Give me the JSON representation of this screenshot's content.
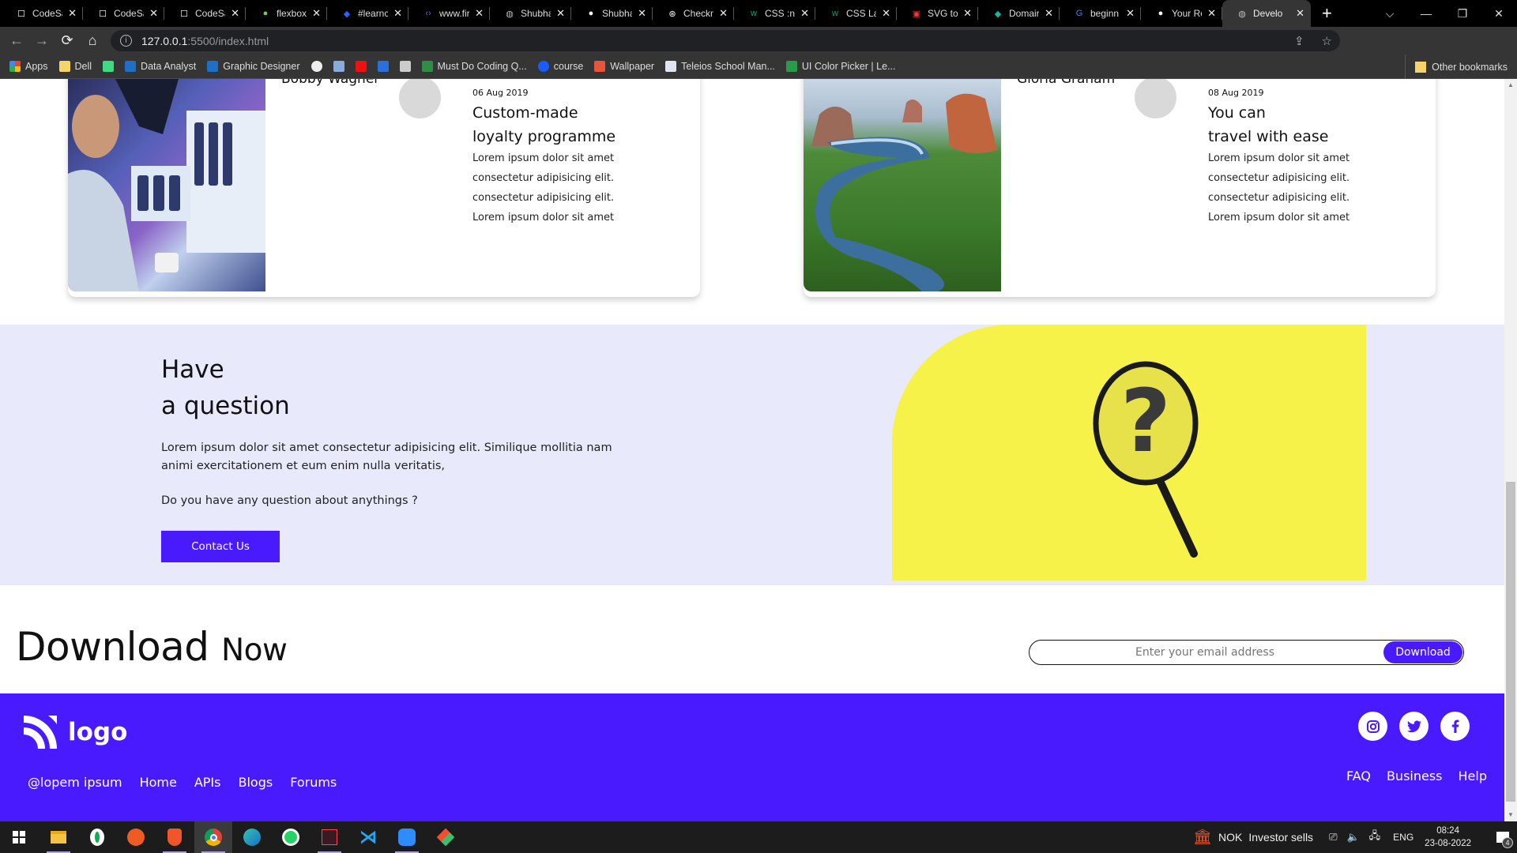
{
  "browser": {
    "tabs": [
      {
        "title": "CodeSa",
        "icon": "codesandbox-icon",
        "active": false
      },
      {
        "title": "CodeSa",
        "icon": "codesandbox-icon",
        "active": false
      },
      {
        "title": "CodeSa",
        "icon": "codesandbox-icon",
        "active": false
      },
      {
        "title": "flexbox",
        "icon": "frog-icon",
        "active": false
      },
      {
        "title": "#learnc",
        "icon": "hashnode-icon",
        "active": false
      },
      {
        "title": "www.fir",
        "icon": "code-icon",
        "active": false
      },
      {
        "title": "Shubha",
        "icon": "globe-icon",
        "active": false
      },
      {
        "title": "Shubha",
        "icon": "github-icon",
        "active": false
      },
      {
        "title": "Checkm",
        "icon": "openai-icon",
        "active": false
      },
      {
        "title": "CSS :nt",
        "icon": "w3schools-icon",
        "active": false
      },
      {
        "title": "CSS Lay",
        "icon": "w3schools-icon",
        "active": false
      },
      {
        "title": "SVG to",
        "icon": "svgpng-icon",
        "active": false
      },
      {
        "title": "Domair",
        "icon": "diamond-icon",
        "active": false
      },
      {
        "title": "beginn",
        "icon": "google-icon",
        "active": false
      },
      {
        "title": "Your Re",
        "icon": "github-icon",
        "active": false
      },
      {
        "title": "Develo",
        "icon": "globe-icon",
        "active": true
      }
    ],
    "url_host": "127.0.0.1",
    "url_path": ":5500/index.html",
    "bookmarks": [
      {
        "label": "Apps",
        "icon": "apps-grid-icon"
      },
      {
        "label": "Dell",
        "icon": "folder-icon"
      },
      {
        "label": "",
        "icon": "android-icon"
      },
      {
        "label": "Data Analyst",
        "icon": "video-icon"
      },
      {
        "label": "Graphic Designer",
        "icon": "video-icon"
      },
      {
        "label": "",
        "icon": "globe-icon"
      },
      {
        "label": "",
        "icon": "mountain-icon"
      },
      {
        "label": "",
        "icon": "t-logo-icon"
      },
      {
        "label": "",
        "icon": "dc-icon"
      },
      {
        "label": "",
        "icon": "badge-icon"
      },
      {
        "label": "Must Do Coding Q...",
        "icon": "gfg-icon"
      },
      {
        "label": "course",
        "icon": "c-logo-icon"
      },
      {
        "label": "Wallpaper",
        "icon": "flame-icon"
      },
      {
        "label": "Teleios School Man...",
        "icon": "document-icon"
      },
      {
        "label": "UI Color Picker | Le...",
        "icon": "play-icon"
      }
    ],
    "other_bookmarks": "Other bookmarks"
  },
  "cards": [
    {
      "author": "Bobby Wagner",
      "date": "06 Aug 2019",
      "title_line1": "Custom-made",
      "title_line2": "loyalty programme",
      "body": [
        "Lorem ipsum dolor sit amet",
        "consectetur adipisicing elit.",
        "consectetur adipisicing elit.",
        "Lorem ipsum dolor sit amet"
      ]
    },
    {
      "author": "Gloria Graham",
      "date": "08 Aug 2019",
      "title_line1": "You can",
      "title_line2": "travel with ease",
      "body": [
        "Lorem ipsum dolor sit amet",
        "consectetur adipisicing elit.",
        "consectetur adipisicing elit.",
        "Lorem ipsum dolor sit amet"
      ]
    }
  ],
  "question": {
    "title_line1": "Have",
    "title_line2": "a question",
    "text": "Lorem ipsum dolor sit amet consectetur adipisicing elit. Similique mollitia nam animi exercitationem et eum enim nulla veritatis,",
    "sub": "Do you have any question about anythings ?",
    "button": "Contact Us"
  },
  "download": {
    "title": "Download",
    "title_suffix": "Now",
    "placeholder": "Enter your email address",
    "button": "Download"
  },
  "footer": {
    "logo": "logo",
    "links_left": [
      "@lopem ipsum",
      "Home",
      "APIs",
      "Blogs",
      "Forums"
    ],
    "links_right": [
      "FAQ",
      "Business",
      "Help"
    ],
    "social": [
      "instagram-icon",
      "twitter-icon",
      "facebook-icon"
    ]
  },
  "colors": {
    "accent": "#4a1aff",
    "question_bg": "#e8eafc",
    "yellow": "#f7f24a"
  },
  "taskbar": {
    "apps": [
      "windows-start-icon",
      "file-explorer-icon",
      "mongodb-icon",
      "postman-icon",
      "brave-icon",
      "chrome-icon",
      "edge-icon",
      "whatsapp-icon",
      "valorant-icon",
      "vscode-icon",
      "zoom-icon",
      "git-icon"
    ],
    "ticker_symbol": "NOK",
    "ticker_text": "Investor sells",
    "language": "ENG",
    "time": "08:24",
    "date": "23-08-2022",
    "notifications": "4"
  }
}
